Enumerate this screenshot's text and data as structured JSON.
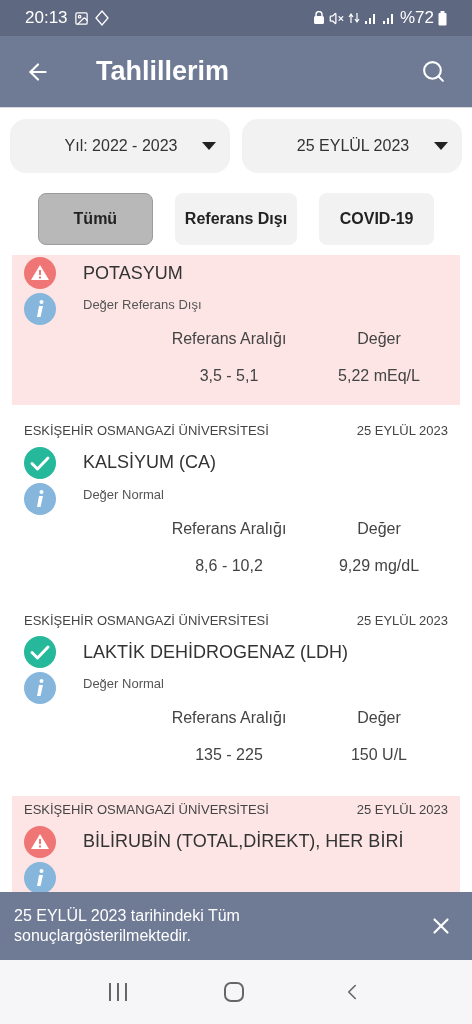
{
  "status_bar": {
    "time": "20:13",
    "battery": "%72"
  },
  "app_bar": {
    "title": "Tahlillerim"
  },
  "filters": [
    {
      "value": "Yıl: 2022 - 2023"
    },
    {
      "value": "25 EYLÜL 2023"
    }
  ],
  "chips": [
    {
      "label": "Tümü",
      "selected": true
    },
    {
      "label": "Referans Dışı",
      "selected": false
    },
    {
      "label": "COVID-19",
      "selected": false
    }
  ],
  "results": [
    {
      "kind": "out_of_range",
      "name": "POTASYUM",
      "status_text": "Değer Referans Dışı",
      "range_label": "Referans Aralığı",
      "value_label": "Değer",
      "range": "3,5 - 5,1",
      "value": "5,22 mEq/L"
    },
    {
      "kind": "normal",
      "institution": "ESKİŞEHİR OSMANGAZİ ÜNİVERSİTESİ",
      "date": "25 EYLÜL 2023",
      "name": "KALSİYUM (CA)",
      "status_text": "Değer Normal",
      "range_label": "Referans Aralığı",
      "value_label": "Değer",
      "range": "8,6 - 10,2",
      "value": "9,29 mg/dL"
    },
    {
      "kind": "normal",
      "institution": "ESKİŞEHİR OSMANGAZİ ÜNİVERSİTESİ",
      "date": "25 EYLÜL 2023",
      "name": "LAKTİK DEHİDROGENAZ (LDH)",
      "status_text": "Değer Normal",
      "range_label": "Referans Aralığı",
      "value_label": "Değer",
      "range": "135 - 225",
      "value": "150 U/L"
    },
    {
      "kind": "out_of_range",
      "institution": "ESKİŞEHİR OSMANGAZİ ÜNİVERSİTESİ",
      "date": "25 EYLÜL 2023",
      "name": "BİLİRUBİN (TOTAL,DİREKT), HER BİRİ"
    }
  ],
  "snackbar": {
    "message": "25 EYLÜL 2023 tarihindeki Tüm sonuçlargösterilmektedir."
  }
}
